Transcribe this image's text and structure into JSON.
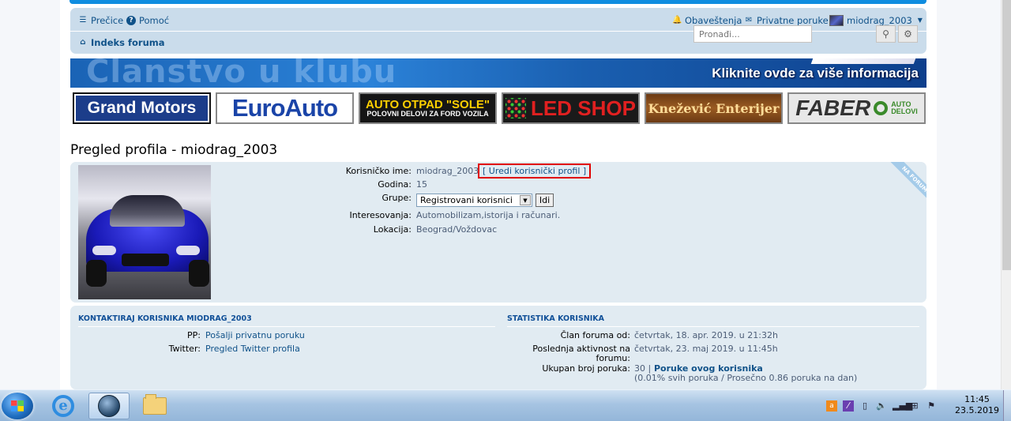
{
  "nav": {
    "precice": "Prečice",
    "pomoc": "Pomoć",
    "index": "Indeks foruma",
    "notifications": "Obaveštenja",
    "pm": "Privatne poruke",
    "user": "miodrag_2003",
    "search_placeholder": "Pronađi..."
  },
  "banner": {
    "big_text": "Članstvo u klubu",
    "cta": "Kliknite ovde za više informacija"
  },
  "ads": {
    "ad1": "Grand Motors",
    "ad2": "EuroAuto",
    "ad3_l1": "AUTO OTPAD \"SOLE\"",
    "ad3_l2": "POLOVNI DELOVI ZA FORD VOZILA",
    "ad4": "LED SHOP",
    "ad5": "Knežević Enterijer",
    "ad6": "FABER",
    "ad6_sub1": "AUTO",
    "ad6_sub2": "DELOVI"
  },
  "title": "Pregled profila - miodrag_2003",
  "profile": {
    "username_label": "Korisničko ime:",
    "username": "miodrag_2003",
    "edit_link": "[ Uredi korisnički profil ]",
    "age_label": "Godina:",
    "age": "15",
    "groups_label": "Grupe:",
    "group_selected": "Registrovani korisnici",
    "go_button": "Idi",
    "interests_label": "Interesovanja:",
    "interests": "Automobilizam,istorija i računari.",
    "location_label": "Lokacija:",
    "location": "Beograd/Voždovac",
    "ribbon": "NA FORUMU"
  },
  "contact": {
    "heading": "KONTAKTIRAJ KORISNIKA MIODRAG_2003",
    "pp_label": "PP:",
    "pp_link": "Pošalji privatnu poruku",
    "twitter_label": "Twitter:",
    "twitter_link": "Pregled Twitter profila"
  },
  "stats": {
    "heading": "STATISTIKA KORISNIKA",
    "member_label": "Član foruma od:",
    "member_value": "četvrtak, 18. apr. 2019. u 21:32h",
    "last_label_1": "Poslednja aktivnost na",
    "last_label_2": "forumu:",
    "last_value": "četvrtak, 23. maj 2019. u 11:45h",
    "posts_label": "Ukupan broj poruka:",
    "posts_count": "30 |",
    "posts_link": "Poruke ovog korisnika",
    "posts_detail": "(0.01% svih poruka / Prosečno 0.86 poruka na dan)"
  },
  "taskbar": {
    "time": "11:45",
    "date": "23.5.2019"
  }
}
